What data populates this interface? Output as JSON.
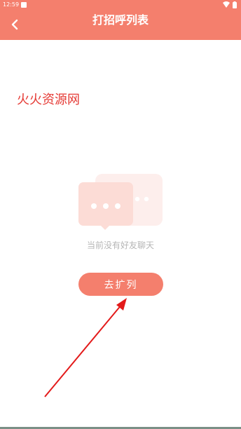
{
  "status_bar": {
    "time": "12:59",
    "icons": [
      "notification-icon",
      "wifi-icon",
      "battery-icon"
    ]
  },
  "header": {
    "title": "打招呼列表",
    "back_icon": "chevron-left-icon"
  },
  "watermark": {
    "text": "火火资源网",
    "color": "#e53a35"
  },
  "empty_state": {
    "illustration_icon": "chat-bubbles-icon",
    "message": "当前没有好友聊天",
    "action_label": "去扩列"
  },
  "annotation": {
    "arrow_icon": "red-arrow-icon",
    "color": "#e31a1a"
  },
  "colors": {
    "accent": "#f47f6d",
    "background": "#ffffff",
    "muted_text": "#b6b6b6"
  }
}
